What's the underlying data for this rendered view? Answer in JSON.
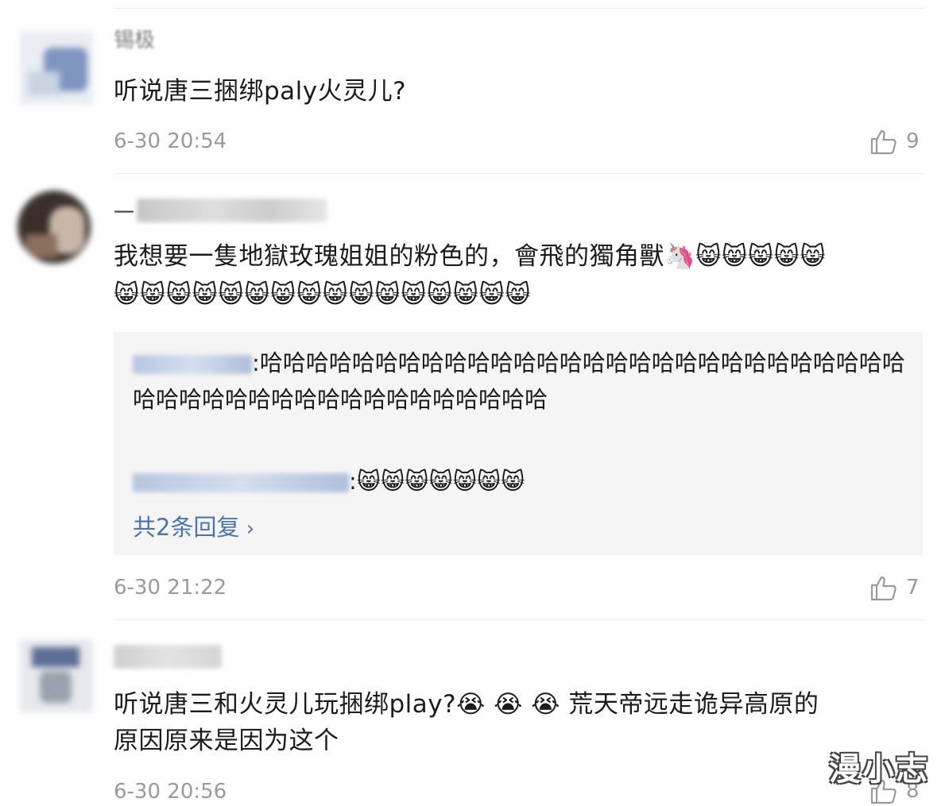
{
  "comments": [
    {
      "author": "锡极",
      "text": "听说唐三捆绑paly火灵儿?",
      "time": "6-30 20:54",
      "likes": "9"
    },
    {
      "author": "一",
      "text_line1": "我想要一隻地獄玫瑰姐姐的粉色的，會飛的獨角獸🦄😸😸😸😸😸",
      "text_line2": "😸😸😸😸😸😸😸😸😸😸😸😸😸😸😸😸",
      "replies": {
        "first_reply": ":哈哈哈哈哈哈哈哈哈哈哈哈哈哈哈哈哈哈哈哈哈哈哈哈哈哈哈哈哈哈哈哈哈哈哈哈哈哈哈哈哈哈哈哈哈哈",
        "second_reply": ":😸😸😸😸😸😸😸",
        "view_more": "共2条回复"
      },
      "time": "6-30 21:22",
      "likes": "7"
    },
    {
      "text_line1": "听说唐三和火灵儿玩捆绑play?😭 😭 😭 荒天帝远走诡异高原的",
      "text_line2": "原因原来是因为这个",
      "time": "6-30 20:56",
      "likes": "8"
    }
  ],
  "watermark": "漫小志",
  "icons": {
    "like": "thumbs-up-icon",
    "chevron": "chevron-right-icon"
  },
  "colors": {
    "link": "#4a74b1",
    "meta": "#9a9a9a",
    "reply_bg": "#f5f5f5"
  }
}
